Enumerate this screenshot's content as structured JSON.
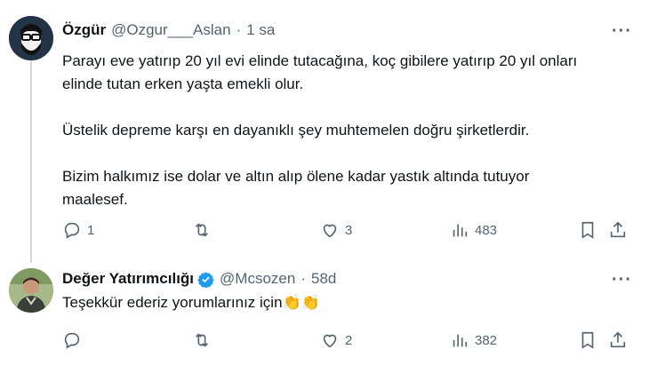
{
  "tweet1": {
    "name": "Özgür",
    "handle": "@Ozgur___Aslan",
    "separator": "·",
    "time": "1 sa",
    "paragraphs": [
      "Parayı eve yatırıp 20 yıl evi elinde tutacağına, koç gibilere yatırıp 20 yıl onları",
      "elinde tutan erken yaşta emekli olur.",
      "",
      "Üstelik depreme karşı en dayanıklı şey muhtemelen doğru şirketlerdir.",
      "",
      "Bizim halkımız ise dolar ve altın alıp ölene kadar yastık altında tutuyor",
      "maalesef."
    ],
    "replies": "1",
    "retweets": "",
    "likes": "3",
    "views": "483"
  },
  "tweet2": {
    "name": "Değer Yatırımcılığı",
    "handle": "@Mcsozen",
    "separator": "·",
    "time": "58d",
    "text": "Teşekkür ederiz yorumlarınız için",
    "emoji": "👏👏",
    "replies": "",
    "retweets": "",
    "likes": "2",
    "views": "382"
  },
  "icons": {
    "more": "more-icon",
    "reply": "reply-icon",
    "retweet": "retweet-icon",
    "like": "heart-icon",
    "views": "views-icon",
    "bookmark": "bookmark-icon",
    "share": "share-icon",
    "verified": "verified-badge-icon"
  },
  "colors": {
    "text": "#0f1419",
    "muted": "#536471",
    "verified": "#1d9bf0",
    "thread_line": "#cfd9de"
  }
}
